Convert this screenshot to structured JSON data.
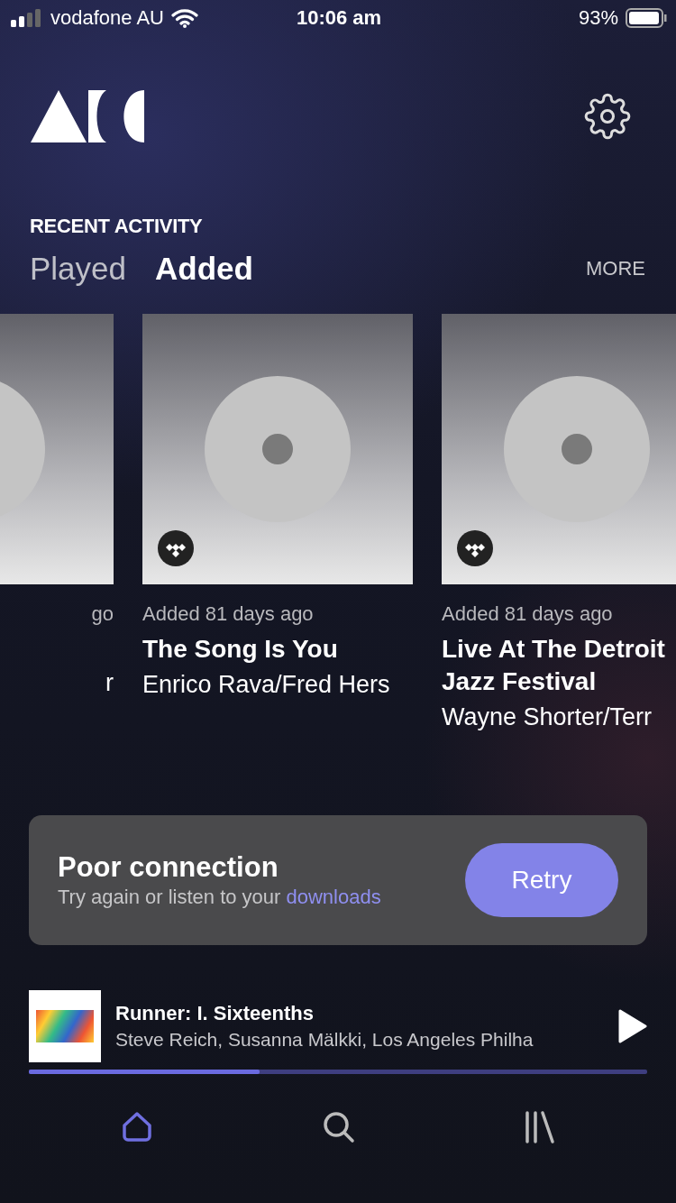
{
  "status_bar": {
    "carrier": "vodafone AU",
    "time": "10:06 am",
    "battery": "93%"
  },
  "section_title": "RECENT ACTIVITY",
  "tabs": [
    {
      "label": "Played",
      "selected": false
    },
    {
      "label": "Added",
      "selected": true
    }
  ],
  "more": "MORE",
  "cards": [
    {
      "kind": "partial",
      "added": "go",
      "artist": "r"
    },
    {
      "kind": "full",
      "added": "Added 81 days ago",
      "title": "The Song Is You",
      "artist": "Enrico Rava/Fred Hers"
    },
    {
      "kind": "full",
      "added": "Added 81 days ago",
      "title": "Live At The Detroit Jazz Festival",
      "artist": "Wayne Shorter/Terr"
    }
  ],
  "banner": {
    "title": "Poor connection",
    "message": "Try again or listen to your",
    "link": "downloads",
    "button": "Retry"
  },
  "now_playing": {
    "title": "Runner: I. Sixteenths",
    "artist": "Steve Reich, Susanna Mälkki, Los Angeles Philha",
    "level": 0.373
  },
  "nav": [
    {
      "kind": "home",
      "selected": true
    },
    {
      "kind": "search",
      "selected": false
    },
    {
      "kind": "library",
      "selected": false
    }
  ]
}
